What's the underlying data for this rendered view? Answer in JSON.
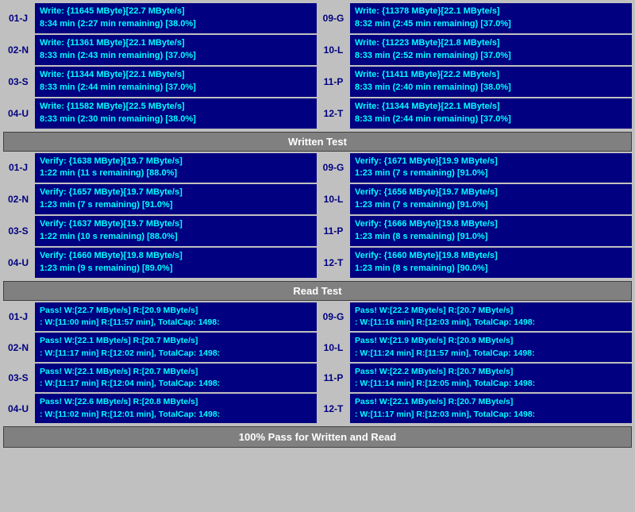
{
  "sections": {
    "written_test": {
      "label": "Written Test",
      "rows": [
        {
          "left_label": "01-J",
          "left_data": "Write: {11645 MByte}[22.7 MByte/s]\n8:34 min (2:27 min remaining)  [38.0%]",
          "right_label": "09-G",
          "right_data": "Write: {11378 MByte}[22.1 MByte/s]\n8:32 min (2:45 min remaining)  [37.0%]"
        },
        {
          "left_label": "02-N",
          "left_data": "Write: {11361 MByte}[22.1 MByte/s]\n8:33 min (2:43 min remaining)  [37.0%]",
          "right_label": "10-L",
          "right_data": "Write: {11223 MByte}[21.8 MByte/s]\n8:33 min (2:52 min remaining)  [37.0%]"
        },
        {
          "left_label": "03-S",
          "left_data": "Write: {11344 MByte}[22.1 MByte/s]\n8:33 min (2:44 min remaining)  [37.0%]",
          "right_label": "11-P",
          "right_data": "Write: {11411 MByte}[22.2 MByte/s]\n8:33 min (2:40 min remaining)  [38.0%]"
        },
        {
          "left_label": "04-U",
          "left_data": "Write: {11582 MByte}[22.5 MByte/s]\n8:33 min (2:30 min remaining)  [38.0%]",
          "right_label": "12-T",
          "right_data": "Write: {11344 MByte}[22.1 MByte/s]\n8:33 min (2:44 min remaining)  [37.0%]"
        }
      ]
    },
    "verify_test": {
      "rows": [
        {
          "left_label": "01-J",
          "left_data": "Verify: {1638 MByte}[19.7 MByte/s]\n1:22 min (11 s remaining)  [88.0%]",
          "right_label": "09-G",
          "right_data": "Verify: {1671 MByte}[19.9 MByte/s]\n1:23 min (7 s remaining)  [91.0%]"
        },
        {
          "left_label": "02-N",
          "left_data": "Verify: {1657 MByte}[19.7 MByte/s]\n1:23 min (7 s remaining)  [91.0%]",
          "right_label": "10-L",
          "right_data": "Verify: {1656 MByte}[19.7 MByte/s]\n1:23 min (7 s remaining)  [91.0%]"
        },
        {
          "left_label": "03-S",
          "left_data": "Verify: {1637 MByte}[19.7 MByte/s]\n1:22 min (10 s remaining)  [88.0%]",
          "right_label": "11-P",
          "right_data": "Verify: {1666 MByte}[19.8 MByte/s]\n1:23 min (8 s remaining)  [91.0%]"
        },
        {
          "left_label": "04-U",
          "left_data": "Verify: {1660 MByte}[19.8 MByte/s]\n1:23 min (9 s remaining)  [89.0%]",
          "right_label": "12-T",
          "right_data": "Verify: {1660 MByte}[19.8 MByte/s]\n1:23 min (8 s remaining)  [90.0%]"
        }
      ]
    },
    "read_test": {
      "label": "Read Test",
      "rows": [
        {
          "left_label": "01-J",
          "left_data": "Pass! W:[22.7 MByte/s] R:[20.9 MByte/s]\n: W:[11:00 min] R:[11:57 min], TotalCap: 1498:",
          "right_label": "09-G",
          "right_data": "Pass! W:[22.2 MByte/s] R:[20.7 MByte/s]\n: W:[11:16 min] R:[12:03 min], TotalCap: 1498:"
        },
        {
          "left_label": "02-N",
          "left_data": "Pass! W:[22.1 MByte/s] R:[20.7 MByte/s]\n: W:[11:17 min] R:[12:02 min], TotalCap: 1498:",
          "right_label": "10-L",
          "right_data": "Pass! W:[21.9 MByte/s] R:[20.9 MByte/s]\n: W:[11:24 min] R:[11:57 min], TotalCap: 1498:"
        },
        {
          "left_label": "03-S",
          "left_data": "Pass! W:[22.1 MByte/s] R:[20.7 MByte/s]\n: W:[11:17 min] R:[12:04 min], TotalCap: 1498:",
          "right_label": "11-P",
          "right_data": "Pass! W:[22.2 MByte/s] R:[20.7 MByte/s]\n: W:[11:14 min] R:[12:05 min], TotalCap: 1498:"
        },
        {
          "left_label": "04-U",
          "left_data": "Pass! W:[22.6 MByte/s] R:[20.8 MByte/s]\n: W:[11:02 min] R:[12:01 min], TotalCap: 1498:",
          "right_label": "12-T",
          "right_data": "Pass! W:[22.1 MByte/s] R:[20.7 MByte/s]\n: W:[11:17 min] R:[12:03 min], TotalCap: 1498:"
        }
      ]
    }
  },
  "headers": {
    "written_test": "Written Test",
    "read_test": "Read Test",
    "bottom_bar": "100% Pass for Written and Read"
  }
}
